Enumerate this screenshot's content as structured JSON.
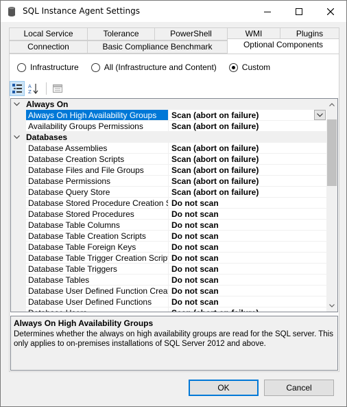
{
  "window": {
    "title": "SQL Instance Agent Settings",
    "icon": "database-icon"
  },
  "tabs": {
    "back_row": [
      "Local Service",
      "Tolerance",
      "PowerShell",
      "WMI",
      "Plugins"
    ],
    "front_row": [
      "Connection",
      "Basic Compliance Benchmark",
      "Optional Components"
    ],
    "active": "Optional Components"
  },
  "scope": {
    "options": [
      "Infrastructure",
      "All (Infrastructure and Content)",
      "Custom"
    ],
    "selected": "Custom"
  },
  "toolbar": {
    "categorized_icon": "categorized-view-icon",
    "alphabetical_icon": "alphabetical-sort-icon",
    "property_pages_icon": "property-pages-icon"
  },
  "grid": {
    "categories": [
      {
        "name": "Always On",
        "properties": [
          {
            "name": "Always On High Availability Groups",
            "value": "Scan (abort on failure)",
            "selected": true
          },
          {
            "name": "Availability Groups Permissions",
            "value": "Scan (abort on failure)"
          }
        ]
      },
      {
        "name": "Databases",
        "properties": [
          {
            "name": "Database Assemblies",
            "value": "Scan (abort on failure)"
          },
          {
            "name": "Database Creation Scripts",
            "value": "Scan (abort on failure)"
          },
          {
            "name": "Database Files and File Groups",
            "value": "Scan (abort on failure)"
          },
          {
            "name": "Database Permissions",
            "value": "Scan (abort on failure)"
          },
          {
            "name": "Database Query Store",
            "value": "Scan (abort on failure)"
          },
          {
            "name": "Database Stored Procedure Creation Scripts",
            "value": "Do not scan"
          },
          {
            "name": "Database Stored Procedures",
            "value": "Do not scan"
          },
          {
            "name": "Database Table Columns",
            "value": "Do not scan"
          },
          {
            "name": "Database Table Creation Scripts",
            "value": "Do not scan"
          },
          {
            "name": "Database Table Foreign Keys",
            "value": "Do not scan"
          },
          {
            "name": "Database Table Trigger Creation Scripts",
            "value": "Do not scan"
          },
          {
            "name": "Database Table Triggers",
            "value": "Do not scan"
          },
          {
            "name": "Database Tables",
            "value": "Do not scan"
          },
          {
            "name": "Database User Defined Function Creation Scripts",
            "value": "Do not scan"
          },
          {
            "name": "Database User Defined Functions",
            "value": "Do not scan"
          },
          {
            "name": "Database Users",
            "value": "Scan (abort on failure)"
          }
        ]
      }
    ]
  },
  "description": {
    "title": "Always On High Availability Groups",
    "text": "Determines whether the always on high availability groups are read for the SQL server. This only applies to on-premises installations of SQL Server 2012 and above."
  },
  "buttons": {
    "ok": "OK",
    "cancel": "Cancel"
  }
}
